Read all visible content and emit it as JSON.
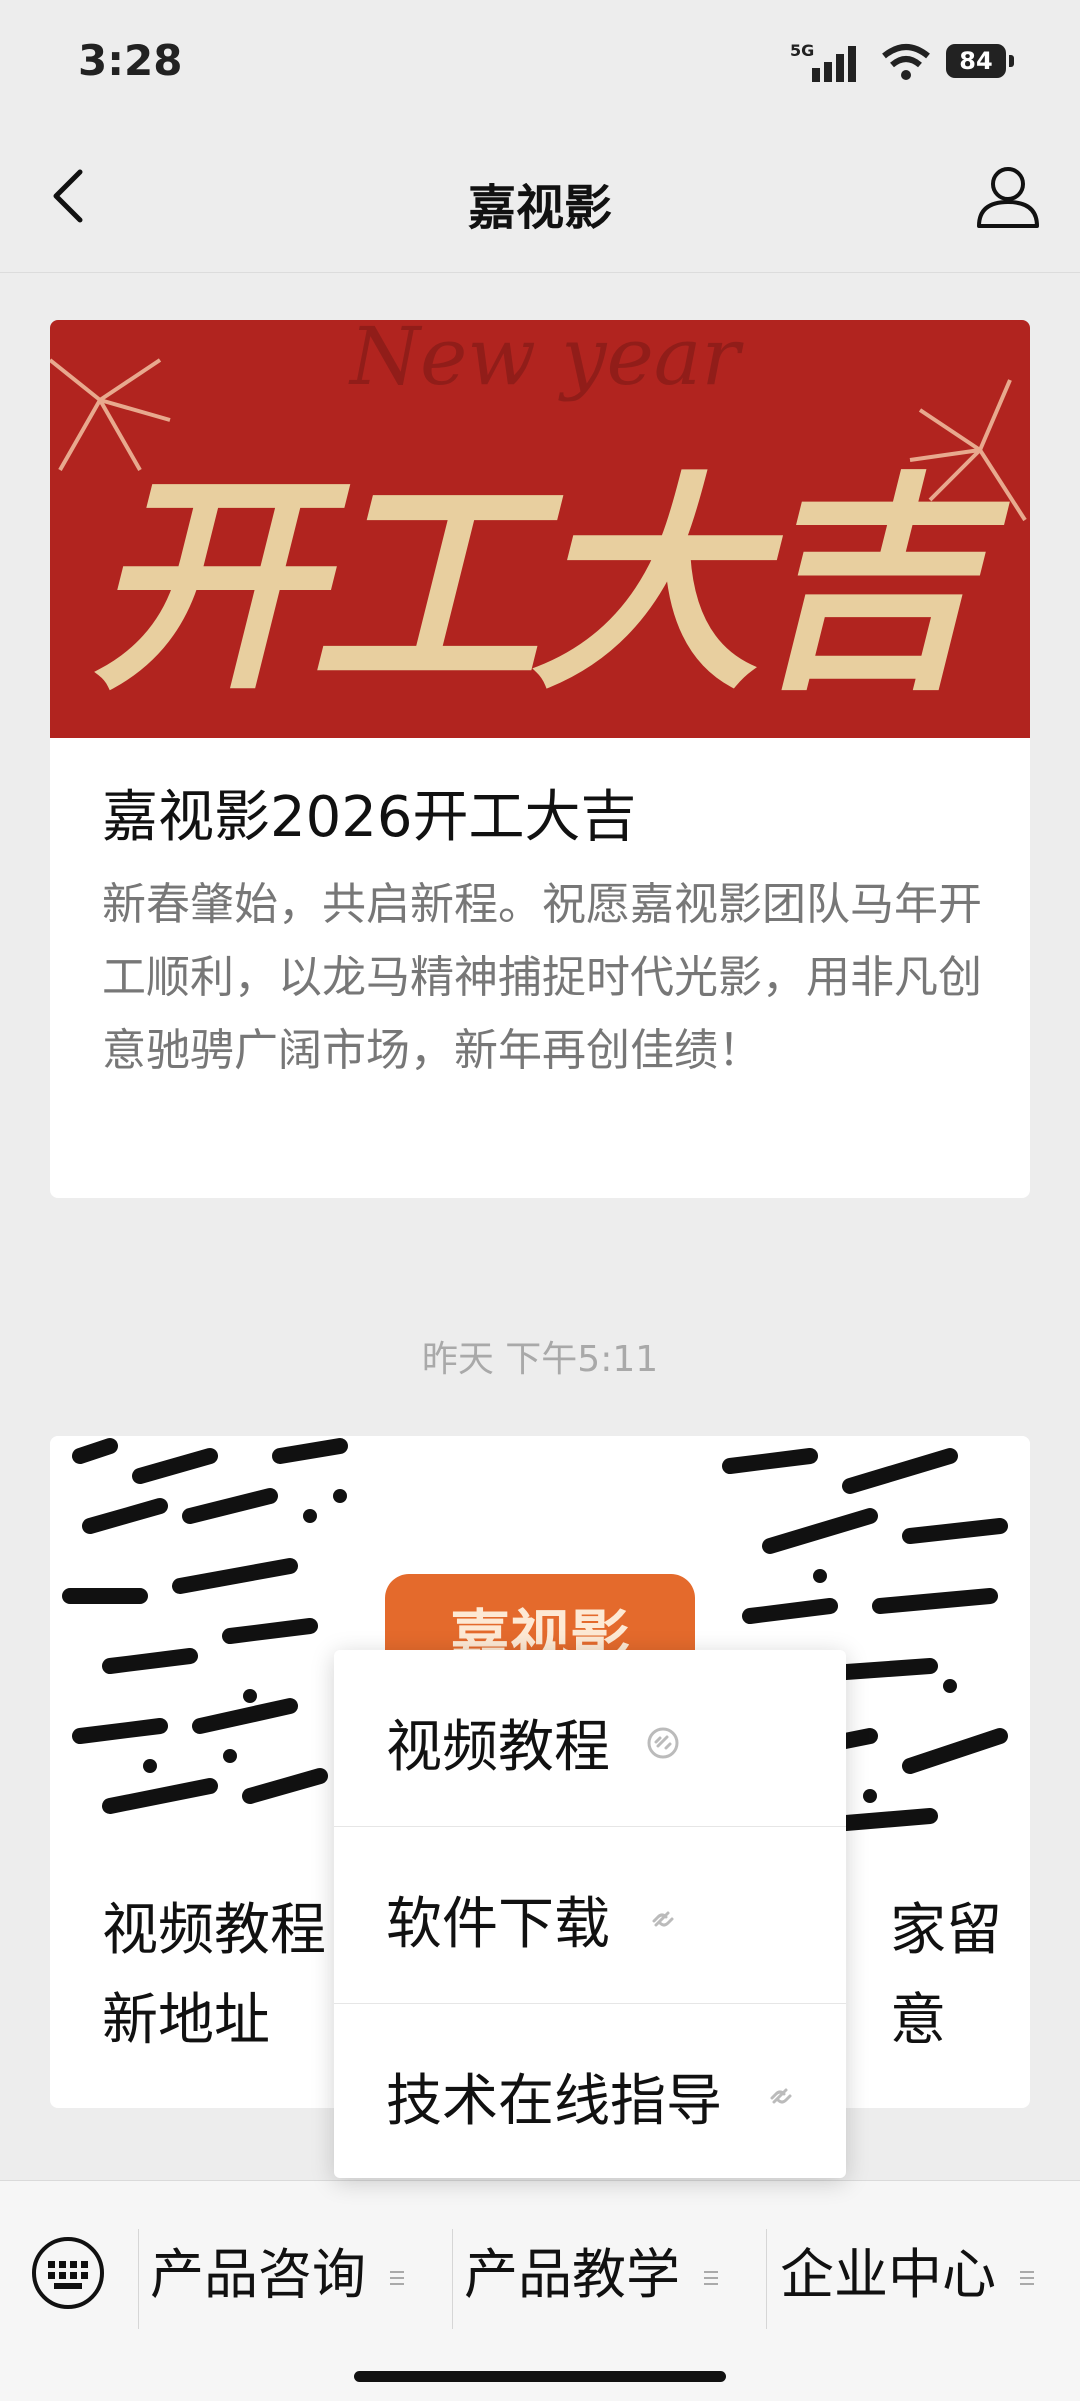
{
  "status": {
    "time": "3:28",
    "network": "5G",
    "battery": "84"
  },
  "nav": {
    "title": "嘉视影"
  },
  "card1": {
    "banner_text": "开工大吉",
    "banner_sub": "New year",
    "title": "嘉视影2026开工大吉",
    "description": "新春肇始，共启新程。祝愿嘉视影团队马年开工顺利，以龙马精神捕捉时代光影，用非凡创意驰骋广阔市场，新年再创佳绩！"
  },
  "timestamp": "昨天 下午5:11",
  "card2": {
    "qr_badge": "嘉视影",
    "title_part1": "视频教程",
    "title_part2": "新地址",
    "title_part3": "家留意"
  },
  "popup_menu": {
    "items": [
      {
        "label": "视频教程"
      },
      {
        "label": "软件下载"
      },
      {
        "label": "技术在线指导"
      }
    ]
  },
  "bottom_menu": {
    "tabs": [
      {
        "label": "产品咨询"
      },
      {
        "label": "产品教学"
      },
      {
        "label": "企业中心"
      }
    ]
  }
}
